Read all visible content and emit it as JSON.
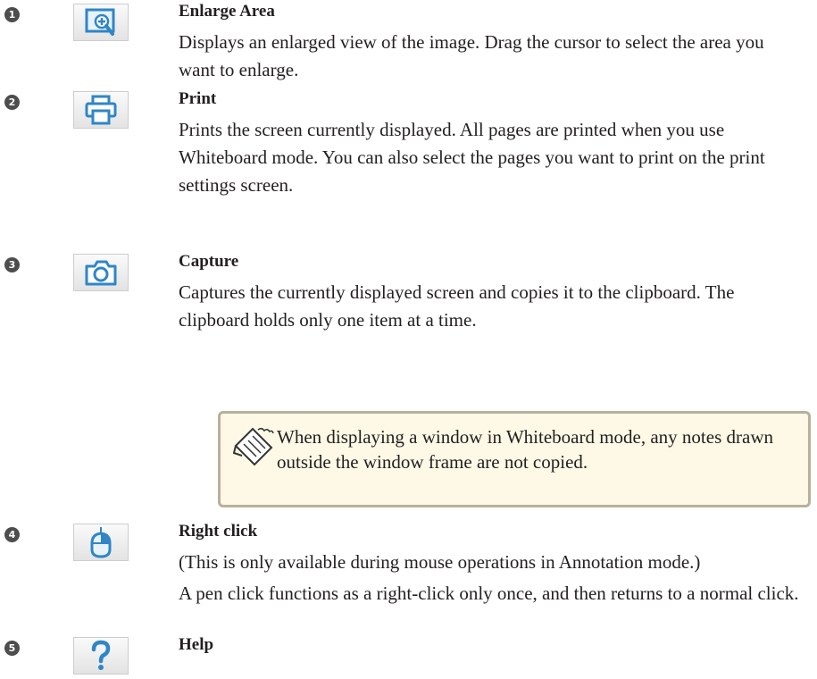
{
  "items": [
    {
      "number": "1",
      "icon": "enlarge-area-icon",
      "title": "Enlarge Area",
      "paragraphs": [
        "Displays an enlarged view of the image. Drag the cursor to select the area you want to enlarge."
      ]
    },
    {
      "number": "2",
      "icon": "printer-icon",
      "title": "Print",
      "paragraphs": [
        "Prints the screen currently displayed. All pages are printed when you use Whiteboard mode. You can also select the pages you want to print on the print settings screen."
      ]
    },
    {
      "number": "3",
      "icon": "camera-icon",
      "title": "Capture",
      "paragraphs": [
        "Captures the currently displayed screen and copies it to the clipboard. The clipboard holds only one item at a time."
      ]
    },
    {
      "number": "4",
      "icon": "mouse-icon",
      "title": "Right click",
      "paragraphs": [
        "(This is only available during mouse operations in Annotation mode.)",
        "A pen click functions as a right-click only once, and then returns to a normal click."
      ]
    },
    {
      "number": "5",
      "icon": "help-icon",
      "title": "Help",
      "paragraphs": []
    }
  ],
  "note": {
    "icon": "note-pencil-icon",
    "text": "When displaying a window in Whiteboard mode, any notes drawn outside the window frame are not copied."
  },
  "colors": {
    "icon_blue": "#2f86c5",
    "note_background": "#fdf9e6",
    "note_border": "#b8b09a",
    "number_badge": "#4d4d4d"
  }
}
